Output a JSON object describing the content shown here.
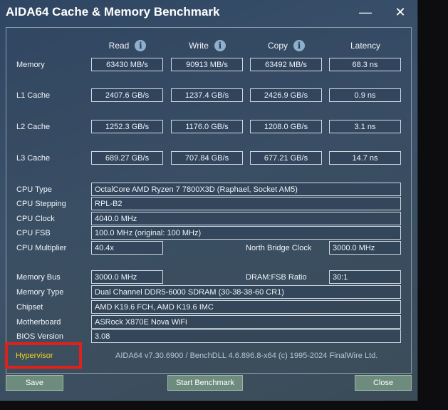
{
  "window": {
    "title": "AIDA64 Cache & Memory Benchmark",
    "minimize_glyph": "—",
    "close_glyph": "✕"
  },
  "columns": {
    "read": "Read",
    "write": "Write",
    "copy": "Copy",
    "latency": "Latency",
    "info_glyph": "i"
  },
  "bench_rows": [
    {
      "label": "Memory",
      "read": "63430 MB/s",
      "write": "90913 MB/s",
      "copy": "63492 MB/s",
      "latency": "68.3 ns"
    },
    {
      "label": "L1 Cache",
      "read": "2407.6 GB/s",
      "write": "1237.4 GB/s",
      "copy": "2426.9 GB/s",
      "latency": "0.9 ns"
    },
    {
      "label": "L2 Cache",
      "read": "1252.3 GB/s",
      "write": "1176.0 GB/s",
      "copy": "1208.0 GB/s",
      "latency": "3.1 ns"
    },
    {
      "label": "L3 Cache",
      "read": "689.27 GB/s",
      "write": "707.84 GB/s",
      "copy": "677.21 GB/s",
      "latency": "14.7 ns"
    }
  ],
  "cpu": {
    "type_label": "CPU Type",
    "type_value": "OctalCore AMD Ryzen 7 7800X3D  (Raphael, Socket AM5)",
    "stepping_label": "CPU Stepping",
    "stepping_value": "RPL-B2",
    "clock_label": "CPU Clock",
    "clock_value": "4040.0 MHz",
    "fsb_label": "CPU FSB",
    "fsb_value": "100.0 MHz  (original: 100 MHz)",
    "multiplier_label": "CPU Multiplier",
    "multiplier_value": "40.4x",
    "nb_clock_label": "North Bridge Clock",
    "nb_clock_value": "3000.0 MHz"
  },
  "memory": {
    "bus_label": "Memory Bus",
    "bus_value": "3000.0 MHz",
    "ratio_label": "DRAM:FSB Ratio",
    "ratio_value": "30:1",
    "type_label": "Memory Type",
    "type_value": "Dual Channel DDR5-6000 SDRAM  (30-38-38-60 CR1)",
    "chipset_label": "Chipset",
    "chipset_value": "AMD K19.6 FCH, AMD K19.6 IMC",
    "motherboard_label": "Motherboard",
    "motherboard_value": "ASRock X870E Nova WiFi",
    "bios_label": "BIOS Version",
    "bios_value": "3.08"
  },
  "footer": {
    "hypervisor": "Hypervisor",
    "copyright": "AIDA64 v7.30.6900 / BenchDLL 4.6.896.8-x64  (c) 1995-2024 FinalWire Ltd.",
    "save": "Save",
    "start": "Start Benchmark",
    "close": "Close"
  },
  "colors": {
    "hypervisor_text": "#f3d21a",
    "highlight_box": "#e0201b",
    "button_bg": "#6e8c7e"
  }
}
